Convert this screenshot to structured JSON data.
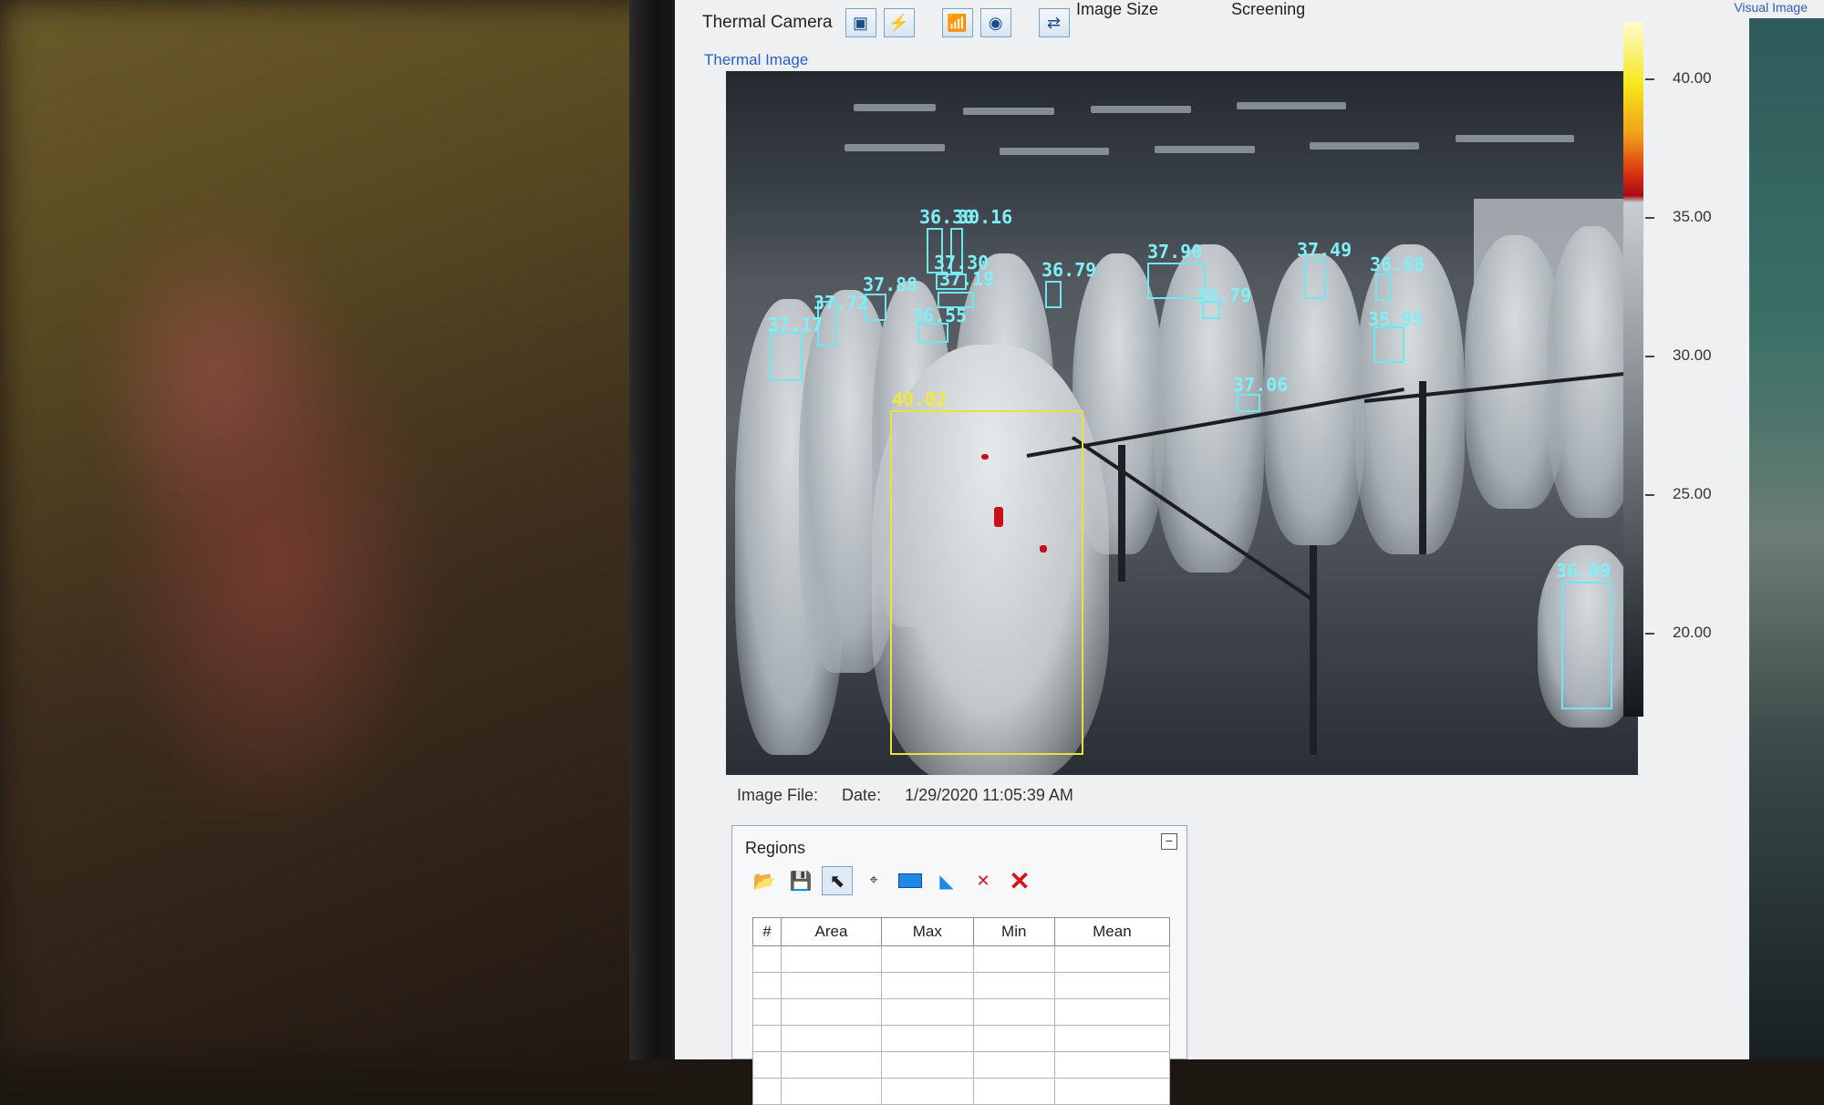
{
  "toolbar": {
    "camera_label": "Thermal Camera",
    "image_size_label": "Image Size",
    "screening_label": "Screening",
    "visual_image_link": "Visual Image"
  },
  "thermal": {
    "view_label": "Thermal Image",
    "scale_labels": [
      "40.00",
      "35.00",
      "30.00",
      "25.00",
      "20.00"
    ],
    "detections": [
      {
        "temp": "36.30",
        "alert": false
      },
      {
        "temp": "30.16",
        "alert": false
      },
      {
        "temp": "37.30",
        "alert": false
      },
      {
        "temp": "37.19",
        "alert": false
      },
      {
        "temp": "37.88",
        "alert": false
      },
      {
        "temp": "37.72",
        "alert": false
      },
      {
        "temp": "37.17",
        "alert": false
      },
      {
        "temp": "36.55",
        "alert": false
      },
      {
        "temp": "36.79",
        "alert": false
      },
      {
        "temp": "37.90",
        "alert": false
      },
      {
        "temp": "36.79",
        "alert": false
      },
      {
        "temp": "37.49",
        "alert": false
      },
      {
        "temp": "36.68",
        "alert": false
      },
      {
        "temp": "35.95",
        "alert": false
      },
      {
        "temp": "37.06",
        "alert": false
      },
      {
        "temp": "40.02",
        "alert": true
      },
      {
        "temp": "36.09",
        "alert": false
      }
    ]
  },
  "file_info": {
    "image_file_label": "Image File:",
    "date_label": "Date:",
    "date_value": "1/29/2020 11:05:39 AM"
  },
  "regions": {
    "title": "Regions",
    "collapse_glyph": "−",
    "columns": [
      "#",
      "Area",
      "Max",
      "Min",
      "Mean"
    ],
    "rows": 6
  }
}
